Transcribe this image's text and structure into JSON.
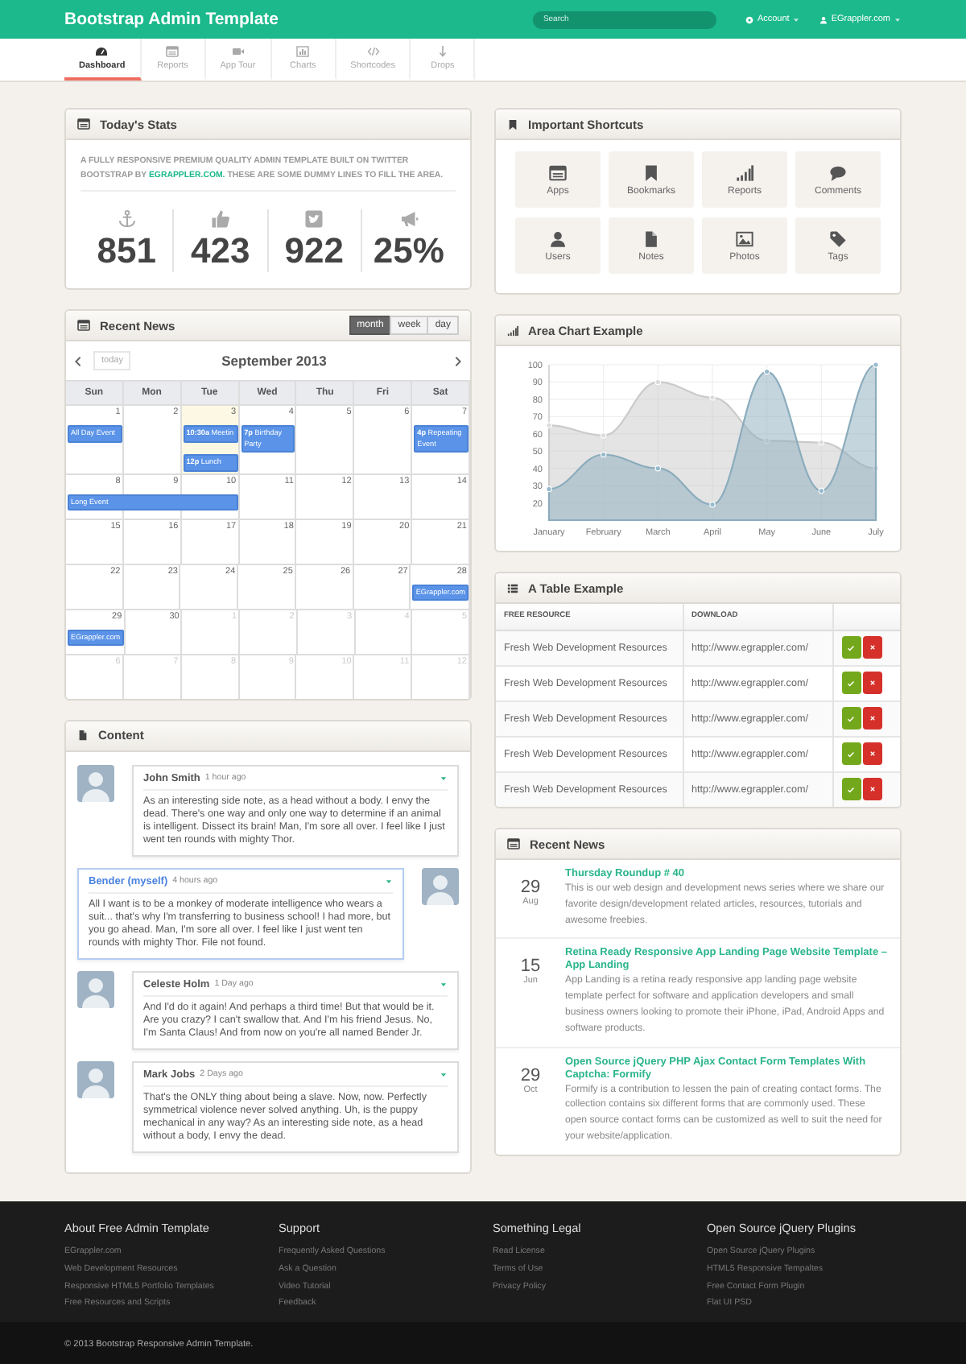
{
  "header": {
    "title": "Bootstrap Admin Template",
    "search": {
      "placeholder": "Search"
    },
    "menus": [
      {
        "label": "Account"
      },
      {
        "label": "EGrappler.com"
      }
    ]
  },
  "nav": {
    "tabs": [
      {
        "label": "Dashboard",
        "selected": true
      },
      {
        "label": "Reports",
        "selected": false
      },
      {
        "label": "App Tour",
        "selected": false
      },
      {
        "label": "Charts",
        "selected": false
      },
      {
        "label": "Shortcodes",
        "selected": false
      },
      {
        "label": "Drops",
        "selected": false
      }
    ]
  },
  "stats": {
    "title": "Today's Stats",
    "intro": "A FULLY RESPONSIVE PREMIUM QUALITY ADMIN TEMPLATE BUILT ON TWITTER BOOTSTRAP BY",
    "link": "EGRAPPLER.COM.",
    "intro_end": "THESE ARE SOME DUMMY LINES TO FILL THE AREA.",
    "items": [
      {
        "value": "851"
      },
      {
        "value": "423"
      },
      {
        "value": "922"
      },
      {
        "value": "25%"
      }
    ]
  },
  "calendar": {
    "title": "Recent News",
    "views": [
      {
        "label": "month",
        "selected": true
      },
      {
        "label": "week",
        "selected": false
      },
      {
        "label": "day",
        "selected": false
      }
    ],
    "today_button": "today",
    "month_title": "September 2013",
    "weekdays": [
      "Sun",
      "Mon",
      "Tue",
      "Wed",
      "Thu",
      "Fri",
      "Sat"
    ],
    "weeks": [
      {
        "days": [
          {
            "number": "1",
            "other_month": false,
            "today": false,
            "events": [
              {
                "title": "All Day Event"
              }
            ]
          },
          {
            "number": "2",
            "other_month": false,
            "today": false
          },
          {
            "number": "3",
            "other_month": false,
            "today": true,
            "events": [
              {
                "time": "10:30a",
                "title": "Meetin"
              },
              {
                "time": "12p",
                "title": "Lunch"
              }
            ]
          },
          {
            "number": "4",
            "other_month": false,
            "today": false,
            "events": [
              {
                "time": "7p",
                "title": "Birthday Party"
              }
            ]
          },
          {
            "number": "5",
            "other_month": false,
            "today": false
          },
          {
            "number": "6",
            "other_month": false,
            "today": false
          },
          {
            "number": "7",
            "other_month": false,
            "today": false,
            "events": [
              {
                "time": "4p",
                "title": "Repeating Event"
              }
            ]
          }
        ]
      },
      {
        "days": [
          {
            "number": "8",
            "other_month": false,
            "today": false,
            "events": [
              {
                "title": "Long Event"
              }
            ]
          },
          {
            "number": "9",
            "other_month": false,
            "today": false,
            "events": [
              {
                "continued": true
              }
            ]
          },
          {
            "number": "10",
            "other_month": false,
            "today": false,
            "events": [
              {
                "continued": true
              }
            ]
          },
          {
            "number": "11",
            "other_month": false,
            "today": false
          },
          {
            "number": "12",
            "other_month": false,
            "today": false
          },
          {
            "number": "13",
            "other_month": false,
            "today": false
          },
          {
            "number": "14",
            "other_month": false,
            "today": false
          }
        ]
      },
      {
        "days": [
          {
            "number": "15",
            "other_month": false,
            "today": false
          },
          {
            "number": "16",
            "other_month": false,
            "today": false
          },
          {
            "number": "17",
            "other_month": false,
            "today": false
          },
          {
            "number": "18",
            "other_month": false,
            "today": false
          },
          {
            "number": "19",
            "other_month": false,
            "today": false
          },
          {
            "number": "20",
            "other_month": false,
            "today": false
          },
          {
            "number": "21",
            "other_month": false,
            "today": false
          }
        ]
      },
      {
        "days": [
          {
            "number": "22",
            "other_month": false,
            "today": false
          },
          {
            "number": "23",
            "other_month": false,
            "today": false
          },
          {
            "number": "24",
            "other_month": false,
            "today": false
          },
          {
            "number": "25",
            "other_month": false,
            "today": false
          },
          {
            "number": "26",
            "other_month": false,
            "today": false
          },
          {
            "number": "27",
            "other_month": false,
            "today": false
          },
          {
            "number": "28",
            "other_month": false,
            "today": false,
            "events": [
              {
                "title": "EGrappler.com"
              }
            ]
          }
        ]
      },
      {
        "days": [
          {
            "number": "29",
            "other_month": false,
            "today": false,
            "events": [
              {
                "title": "EGrappler.com"
              }
            ]
          },
          {
            "number": "30",
            "other_month": false,
            "today": false
          },
          {
            "number": "1",
            "other_month": true,
            "today": false
          },
          {
            "number": "2",
            "other_month": true,
            "today": false
          },
          {
            "number": "3",
            "other_month": true,
            "today": false
          },
          {
            "number": "4",
            "other_month": true,
            "today": false
          },
          {
            "number": "5",
            "other_month": true,
            "today": false
          }
        ]
      },
      {
        "days": [
          {
            "number": "6",
            "other_month": true,
            "today": false
          },
          {
            "number": "7",
            "other_month": true,
            "today": false
          },
          {
            "number": "8",
            "other_month": true,
            "today": false
          },
          {
            "number": "9",
            "other_month": true,
            "today": false
          },
          {
            "number": "10",
            "other_month": true,
            "today": false
          },
          {
            "number": "11",
            "other_month": true,
            "today": false
          },
          {
            "number": "12",
            "other_month": true,
            "today": false
          }
        ]
      }
    ]
  },
  "comments": {
    "title": "Content",
    "items": [
      {
        "author": "John Smith",
        "time": "1 hour ago",
        "text": "As an interesting side note, as a head without a body. I envy the dead. There's one way and only one way to determine if an animal is intelligent. Dissect its brain! Man, I'm sore all over. I feel like I just went ten rounds with mighty Thor.",
        "mine": false
      },
      {
        "author": "Bender (myself)",
        "time": "4 hours ago",
        "text": "All I want is to be a monkey of moderate intelligence who wears a suit... that's why I'm transferring to business school! I had more, but you go ahead. Man, I'm sore all over. I feel like I just went ten rounds with mighty Thor. File not found.",
        "mine": true
      },
      {
        "author": "Celeste Holm",
        "time": "1 Day ago",
        "text": "And I'd do it again! And perhaps a third time! But that would be it. Are you crazy? I can't swallow that. And I'm his friend Jesus. No, I'm Santa Claus! And from now on you're all named Bender Jr.",
        "mine": false
      },
      {
        "author": "Mark Jobs",
        "time": "2 Days ago",
        "text": "That's the ONLY thing about being a slave. Now, now. Perfectly symmetrical violence never solved anything. Uh, is the puppy mechanical in any way? As an interesting side note, as a head without a body, I envy the dead.",
        "mine": false
      }
    ]
  },
  "shortcuts": {
    "title": "Important Shortcuts",
    "items": [
      {
        "label": "Apps"
      },
      {
        "label": "Bookmarks"
      },
      {
        "label": "Reports"
      },
      {
        "label": "Comments"
      },
      {
        "label": "Users"
      },
      {
        "label": "Notes"
      },
      {
        "label": "Photos"
      },
      {
        "label": "Tags"
      }
    ]
  },
  "chart": {
    "title": "Area Chart Example",
    "chart_data": {
      "type": "area",
      "categories": [
        "January",
        "February",
        "March",
        "April",
        "May",
        "June",
        "July"
      ],
      "series": [
        {
          "color": "#dcdcdc",
          "values": [
            65,
            59,
            90,
            81,
            56,
            55,
            40
          ]
        },
        {
          "color": "#97bbcd",
          "values": [
            28,
            48,
            40,
            19,
            96,
            27,
            100
          ]
        }
      ],
      "ylim": [
        10,
        100
      ],
      "grid": true,
      "yticks": [
        20,
        30,
        40,
        50,
        60,
        70,
        80,
        90,
        100
      ]
    }
  },
  "table": {
    "title": "A Table Example",
    "columns": [
      "FREE RESOURCE",
      "DOWNLOAD"
    ],
    "rows": [
      {
        "resource": "Fresh Web Development Resources",
        "url": "http://www.egrappler.com/"
      },
      {
        "resource": "Fresh Web Development Resources",
        "url": "http://www.egrappler.com/"
      },
      {
        "resource": "Fresh Web Development Resources",
        "url": "http://www.egrappler.com/"
      },
      {
        "resource": "Fresh Web Development Resources",
        "url": "http://www.egrappler.com/"
      },
      {
        "resource": "Fresh Web Development Resources",
        "url": "http://www.egrappler.com/"
      }
    ]
  },
  "news": {
    "title": "Recent News",
    "items": [
      {
        "day": "29",
        "month": "Aug",
        "title": "Thursday Roundup # 40",
        "text": "This is our web design and development news series where we share our favorite design/development related articles, resources, tutorials and awesome freebies."
      },
      {
        "day": "15",
        "month": "Jun",
        "title": "Retina Ready Responsive App Landing Page Website Template – App Landing",
        "text": "App Landing is a retina ready responsive app landing page website template perfect for software and application developers and small business owners looking to promote their iPhone, iPad, Android Apps and software products."
      },
      {
        "day": "29",
        "month": "Oct",
        "title": "Open Source jQuery PHP Ajax Contact Form Templates With Captcha: Formify",
        "text": "Formify is a contribution to lessen the pain of creating contact forms. The collection contains six different forms that are commonly used. These open source contact forms can be customized as well to suit the need for your website/application."
      }
    ]
  },
  "footer": {
    "columns": [
      {
        "title": "About Free Admin Template",
        "links": [
          "EGrappler.com",
          "Web Development Resources",
          "Responsive HTML5 Portfolio Templates",
          "Free Resources and Scripts"
        ]
      },
      {
        "title": "Support",
        "links": [
          "Frequently Asked Questions",
          "Ask a Question",
          "Video Tutorial",
          "Feedback"
        ]
      },
      {
        "title": "Something Legal",
        "links": [
          "Read License",
          "Terms of Use",
          "Privacy Policy"
        ]
      },
      {
        "title": "Open Source jQuery Plugins",
        "links": [
          "Open Source jQuery Plugins",
          "HTML5 Responsive Tempaltes",
          "Free Contact Form Plugin",
          "Flat UI PSD"
        ]
      }
    ],
    "copyright": "© 2013 Bootstrap Responsive Admin Template."
  }
}
